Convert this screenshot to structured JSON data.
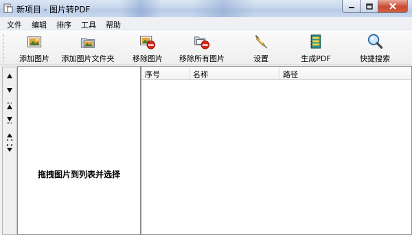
{
  "window": {
    "title": "新项目 - 图片转PDF"
  },
  "menu": [
    "文件",
    "编辑",
    "排序",
    "工具",
    "帮助"
  ],
  "toolbar": {
    "add_image": "添加图片",
    "add_folder": "添加图片文件夹",
    "remove_image": "移除图片",
    "remove_all": "移除所有图片",
    "settings": "设置",
    "generate_pdf": "生成PDF",
    "quick_search": "快捷搜索"
  },
  "left_panel": {
    "hint": "拖拽图片到列表并选择"
  },
  "list": {
    "columns": [
      "序号",
      "名称",
      "路径"
    ]
  }
}
